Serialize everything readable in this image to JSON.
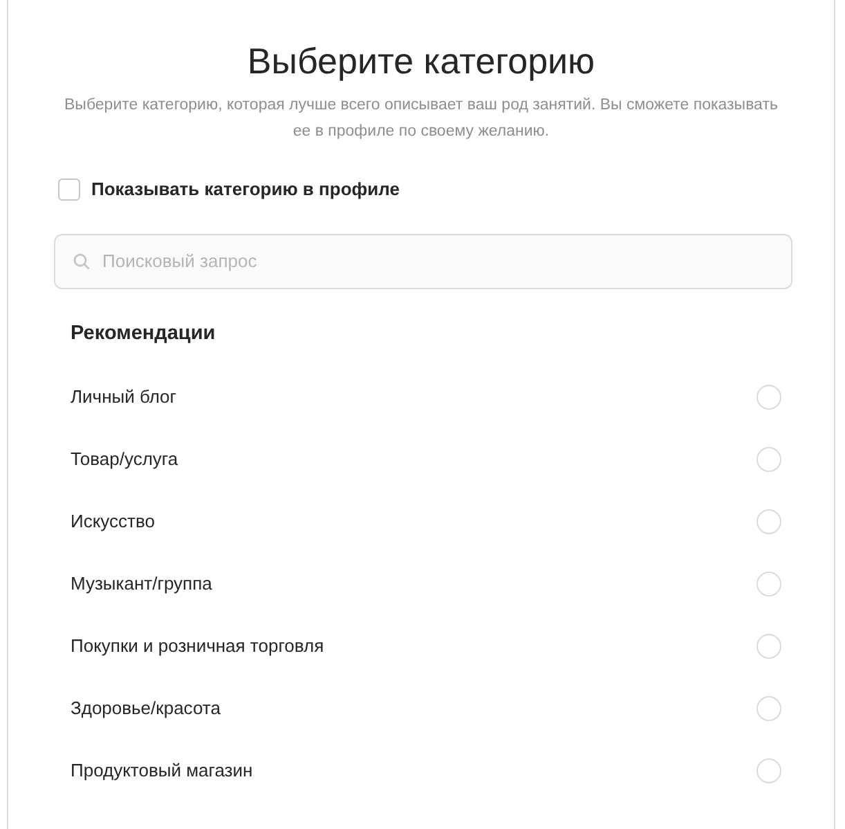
{
  "title": "Выберите категорию",
  "subtitle": "Выберите категорию, которая лучше всего описывает ваш род занятий. Вы сможете показывать ее в профиле по своему желанию.",
  "show_in_profile": {
    "label": "Показывать категорию в профиле",
    "checked": false
  },
  "search": {
    "placeholder": "Поисковый запрос"
  },
  "section_title": "Рекомендации",
  "categories": [
    {
      "label": "Личный блог",
      "selected": false
    },
    {
      "label": "Товар/услуга",
      "selected": false
    },
    {
      "label": "Искусство",
      "selected": false
    },
    {
      "label": "Музыкант/группа",
      "selected": false
    },
    {
      "label": "Покупки и розничная торговля",
      "selected": false
    },
    {
      "label": "Здоровье/красота",
      "selected": false
    },
    {
      "label": "Продуктовый магазин",
      "selected": false
    }
  ]
}
